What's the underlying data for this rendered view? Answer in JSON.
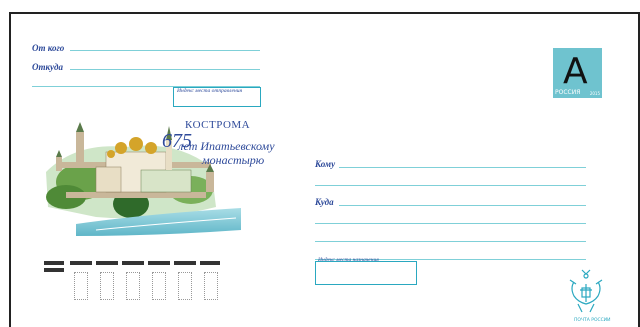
{
  "sender": {
    "from_label": "От кого",
    "where_label": "Откуда",
    "index_label": "Индекс места отправления"
  },
  "recipient": {
    "to_label": "Кому",
    "where_label": "Куда",
    "index_label": "Индекс места назначения"
  },
  "stamp": {
    "letter": "А",
    "country": "РОССИЯ",
    "year": "2015"
  },
  "illustration": {
    "city": "КОСТРОМА",
    "anniversary_number": "675",
    "line1": "лет Ипатьевскому",
    "line2": "монастырю"
  },
  "footer": {
    "post_label": "ПОЧТА РОССИИ"
  },
  "colors": {
    "text": "#2e4a9a",
    "lines": "#7fd0d8",
    "stamp": "#6fc3cf",
    "emblem": "#2aa8c0"
  }
}
